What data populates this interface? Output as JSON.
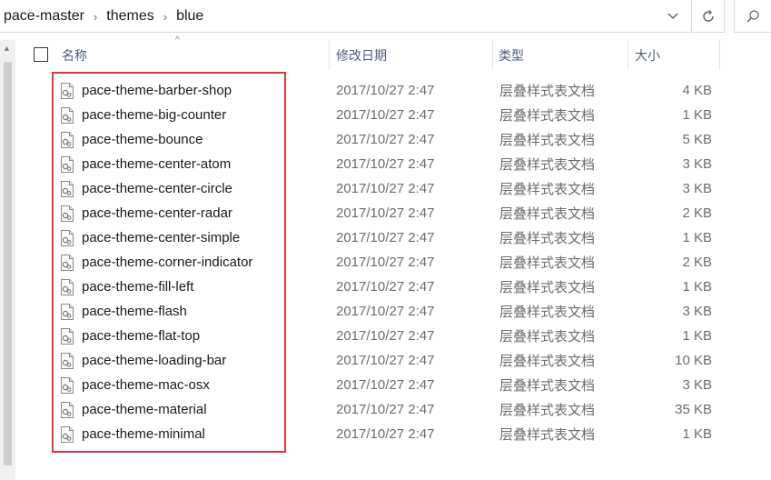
{
  "breadcrumb": {
    "segments": [
      "pace-master",
      "themes",
      "blue"
    ],
    "separator": "›"
  },
  "icons": {
    "dropdown": "chevron-down-icon",
    "refresh": "refresh-icon",
    "search": "search-icon",
    "file": "css-file-icon",
    "sort": "sort-ascending-icon"
  },
  "columns": {
    "name": "名称",
    "date": "修改日期",
    "type": "类型",
    "size": "大小"
  },
  "files": [
    {
      "name": "pace-theme-barber-shop",
      "date": "2017/10/27 2:47",
      "type": "层叠样式表文档",
      "size": "4 KB"
    },
    {
      "name": "pace-theme-big-counter",
      "date": "2017/10/27 2:47",
      "type": "层叠样式表文档",
      "size": "1 KB"
    },
    {
      "name": "pace-theme-bounce",
      "date": "2017/10/27 2:47",
      "type": "层叠样式表文档",
      "size": "5 KB"
    },
    {
      "name": "pace-theme-center-atom",
      "date": "2017/10/27 2:47",
      "type": "层叠样式表文档",
      "size": "3 KB"
    },
    {
      "name": "pace-theme-center-circle",
      "date": "2017/10/27 2:47",
      "type": "层叠样式表文档",
      "size": "3 KB"
    },
    {
      "name": "pace-theme-center-radar",
      "date": "2017/10/27 2:47",
      "type": "层叠样式表文档",
      "size": "2 KB"
    },
    {
      "name": "pace-theme-center-simple",
      "date": "2017/10/27 2:47",
      "type": "层叠样式表文档",
      "size": "1 KB"
    },
    {
      "name": "pace-theme-corner-indicator",
      "date": "2017/10/27 2:47",
      "type": "层叠样式表文档",
      "size": "2 KB"
    },
    {
      "name": "pace-theme-fill-left",
      "date": "2017/10/27 2:47",
      "type": "层叠样式表文档",
      "size": "1 KB"
    },
    {
      "name": "pace-theme-flash",
      "date": "2017/10/27 2:47",
      "type": "层叠样式表文档",
      "size": "3 KB"
    },
    {
      "name": "pace-theme-flat-top",
      "date": "2017/10/27 2:47",
      "type": "层叠样式表文档",
      "size": "1 KB"
    },
    {
      "name": "pace-theme-loading-bar",
      "date": "2017/10/27 2:47",
      "type": "层叠样式表文档",
      "size": "10 KB"
    },
    {
      "name": "pace-theme-mac-osx",
      "date": "2017/10/27 2:47",
      "type": "层叠样式表文档",
      "size": "3 KB"
    },
    {
      "name": "pace-theme-material",
      "date": "2017/10/27 2:47",
      "type": "层叠样式表文档",
      "size": "35 KB"
    },
    {
      "name": "pace-theme-minimal",
      "date": "2017/10/27 2:47",
      "type": "层叠样式表文档",
      "size": "1 KB"
    }
  ],
  "colors": {
    "highlight": "#e0373a",
    "header_text": "#4c607a",
    "secondary_text": "#6d6d6d"
  }
}
